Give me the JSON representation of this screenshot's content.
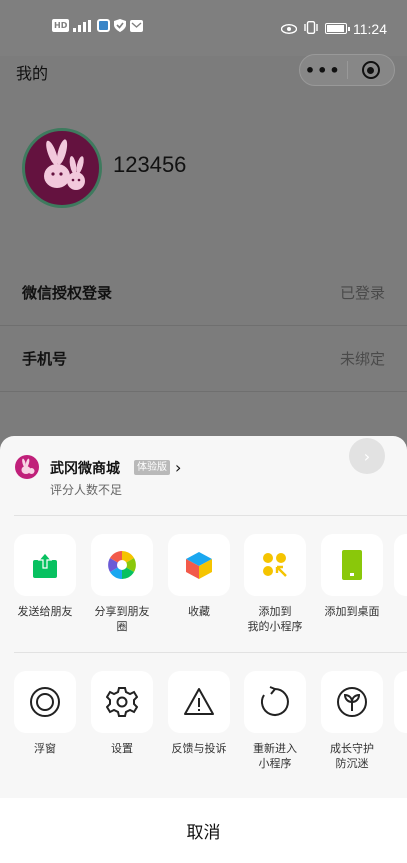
{
  "status_bar": {
    "time": "11:24",
    "left_icons": [
      "hd-icon",
      "signal-icon",
      "app-icon",
      "shield-icon",
      "mail-icon"
    ],
    "hd_text": "HD",
    "battery_percent": 95
  },
  "header": {
    "title": "我的",
    "more_label": "•••"
  },
  "profile": {
    "username": "123456"
  },
  "rows": [
    {
      "label": "微信授权登录",
      "value": "已登录"
    },
    {
      "label": "手机号",
      "value": "未绑定"
    }
  ],
  "sheet": {
    "app_name": "武冈微商城",
    "badge": "体验版",
    "rating": "评分人数不足",
    "share_items": [
      {
        "label": "发送给朋友",
        "icon": "share-friend-icon"
      },
      {
        "label": "分享到朋友圈",
        "icon": "moments-icon"
      },
      {
        "label": "收藏",
        "icon": "favorite-icon"
      },
      {
        "label": "添加到我的小程序",
        "icon": "add-miniprogram-icon"
      },
      {
        "label": "添加到桌面",
        "icon": "add-desktop-icon"
      }
    ],
    "action_items": [
      {
        "label": "浮窗",
        "icon": "float-window-icon"
      },
      {
        "label": "设置",
        "icon": "settings-icon"
      },
      {
        "label": "反馈与投诉",
        "icon": "warning-icon"
      },
      {
        "label": "重新进入小程序",
        "icon": "reload-icon"
      },
      {
        "label": "成长守护防沉迷",
        "icon": "sprout-icon"
      }
    ],
    "cancel": "取消"
  },
  "colors": {
    "overlay": "#7c7c7c",
    "share_green": "#07c160",
    "star_yellow": "#f5c400",
    "desktop_green": "#8ac80a"
  }
}
